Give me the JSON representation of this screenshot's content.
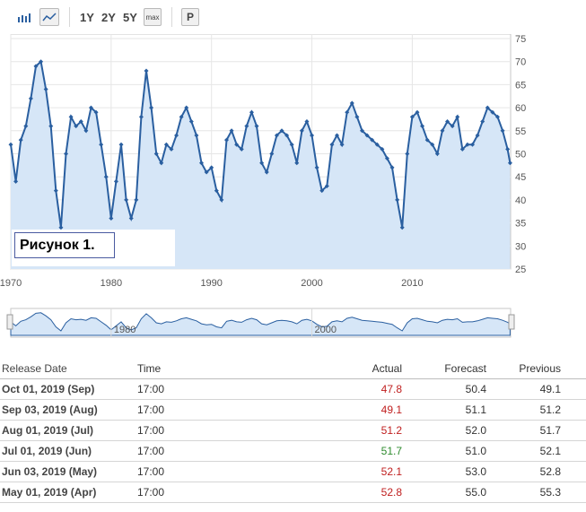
{
  "toolbar": {
    "chart_types": [
      {
        "icon": "bar-chart-icon"
      },
      {
        "icon": "line-chart-icon",
        "active": true
      }
    ],
    "ranges": [
      "1Y",
      "2Y",
      "5Y",
      "max"
    ],
    "print_label": "P"
  },
  "figure_label": "Рисунок 1.",
  "colors": {
    "line": "#2a5fa0",
    "fill": "#d6e6f7",
    "negative": "#c02020",
    "positive": "#2e8b2e"
  },
  "chart_data": {
    "type": "area",
    "x_ticks": [
      "1970",
      "1980",
      "1990",
      "2000",
      "2010"
    ],
    "y_ticks": [
      "25",
      "30",
      "35",
      "40",
      "45",
      "50",
      "55",
      "60",
      "65",
      "70",
      "75"
    ],
    "ylim": [
      25,
      75
    ],
    "xlim": [
      1970,
      2019.8
    ],
    "y_axis_position": "right",
    "grid": true,
    "x": [
      1970.0,
      1970.5,
      1971.0,
      1971.5,
      1972.0,
      1972.5,
      1973.0,
      1973.5,
      1974.0,
      1974.5,
      1975.0,
      1975.5,
      1976.0,
      1976.5,
      1977.0,
      1977.5,
      1978.0,
      1978.5,
      1979.0,
      1979.5,
      1980.0,
      1980.5,
      1981.0,
      1981.5,
      1982.0,
      1982.5,
      1983.0,
      1983.5,
      1984.0,
      1984.5,
      1985.0,
      1985.5,
      1986.0,
      1986.5,
      1987.0,
      1987.5,
      1988.0,
      1988.5,
      1989.0,
      1989.5,
      1990.0,
      1990.5,
      1991.0,
      1991.5,
      1992.0,
      1992.5,
      1993.0,
      1993.5,
      1994.0,
      1994.5,
      1995.0,
      1995.5,
      1996.0,
      1996.5,
      1997.0,
      1997.5,
      1998.0,
      1998.5,
      1999.0,
      1999.5,
      2000.0,
      2000.5,
      2001.0,
      2001.5,
      2002.0,
      2002.5,
      2003.0,
      2003.5,
      2004.0,
      2004.5,
      2005.0,
      2005.5,
      2006.0,
      2006.5,
      2007.0,
      2007.5,
      2008.0,
      2008.5,
      2009.0,
      2009.5,
      2010.0,
      2010.5,
      2011.0,
      2011.5,
      2012.0,
      2012.5,
      2013.0,
      2013.5,
      2014.0,
      2014.5,
      2015.0,
      2015.5,
      2016.0,
      2016.5,
      2017.0,
      2017.5,
      2018.0,
      2018.5,
      2019.0,
      2019.5,
      2019.75
    ],
    "values": [
      52,
      44,
      53,
      56,
      62,
      69,
      70,
      64,
      56,
      42,
      34,
      50,
      58,
      56,
      57,
      55,
      60,
      59,
      52,
      45,
      36,
      44,
      52,
      40,
      36,
      40,
      58,
      68,
      60,
      50,
      48,
      52,
      51,
      54,
      58,
      60,
      57,
      54,
      48,
      46,
      47,
      42,
      40,
      53,
      55,
      52,
      51,
      56,
      59,
      56,
      48,
      46,
      50,
      54,
      55,
      54,
      52,
      48,
      55,
      57,
      54,
      47,
      42,
      43,
      52,
      54,
      52,
      59,
      61,
      58,
      55,
      54,
      53,
      52,
      51,
      49,
      47,
      40,
      34,
      50,
      58,
      59,
      56,
      53,
      52,
      50,
      55,
      57,
      56,
      58,
      51,
      52,
      52,
      54,
      57,
      60,
      59,
      58,
      55,
      51,
      48
    ]
  },
  "navigator": {
    "labels": [
      "1980",
      "2000"
    ]
  },
  "table": {
    "headers": {
      "date": "Release Date",
      "time": "Time",
      "actual": "Actual",
      "forecast": "Forecast",
      "previous": "Previous"
    },
    "rows": [
      {
        "date": "Oct 01, 2019 (Sep)",
        "time": "17:00",
        "actual": "47.8",
        "actual_trend": "down",
        "forecast": "50.4",
        "previous": "49.1"
      },
      {
        "date": "Sep 03, 2019 (Aug)",
        "time": "17:00",
        "actual": "49.1",
        "actual_trend": "down",
        "forecast": "51.1",
        "previous": "51.2"
      },
      {
        "date": "Aug 01, 2019 (Jul)",
        "time": "17:00",
        "actual": "51.2",
        "actual_trend": "down",
        "forecast": "52.0",
        "previous": "51.7"
      },
      {
        "date": "Jul 01, 2019 (Jun)",
        "time": "17:00",
        "actual": "51.7",
        "actual_trend": "up",
        "forecast": "51.0",
        "previous": "52.1"
      },
      {
        "date": "Jun 03, 2019 (May)",
        "time": "17:00",
        "actual": "52.1",
        "actual_trend": "down",
        "forecast": "53.0",
        "previous": "52.8"
      },
      {
        "date": "May 01, 2019 (Apr)",
        "time": "17:00",
        "actual": "52.8",
        "actual_trend": "down",
        "forecast": "55.0",
        "previous": "55.3"
      }
    ]
  }
}
